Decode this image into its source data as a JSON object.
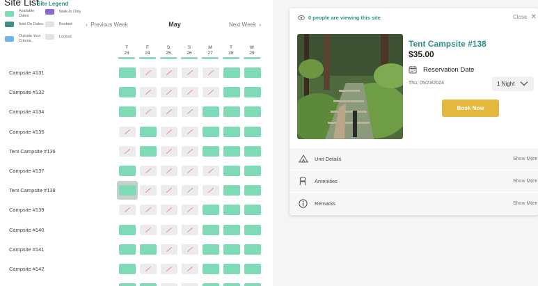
{
  "site_list": {
    "title": "Site List",
    "legend_link": "Site Legend",
    "legend": [
      {
        "label": "Available Dates",
        "color": "#7fdbb6"
      },
      {
        "label": "Add-On Dates",
        "color": "#3d8f86"
      },
      {
        "label": "Outside Your Criteria",
        "color": "#6fb4e8"
      },
      {
        "label": "Walk-In Only",
        "color": "#8c66d9",
        "glyph": "☰"
      },
      {
        "label": "Booked",
        "color": "#e3e3e3",
        "glyph": "∕"
      },
      {
        "label": "Locked",
        "color": "#e3e3e3",
        "glyph": "▣"
      }
    ]
  },
  "nav": {
    "prev_label": "Previous Week",
    "month": "May",
    "next_label": "Next Week"
  },
  "days": [
    {
      "dow": "T",
      "date": "23"
    },
    {
      "dow": "F",
      "date": "24"
    },
    {
      "dow": "S",
      "date": "25"
    },
    {
      "dow": "S",
      "date": "26"
    },
    {
      "dow": "M",
      "date": "27"
    },
    {
      "dow": "T",
      "date": "28"
    },
    {
      "dow": "W",
      "date": "29"
    }
  ],
  "sites": [
    {
      "name": "Campsite #131",
      "status": [
        "a",
        "b",
        "b",
        "b",
        "b",
        "a",
        "a"
      ]
    },
    {
      "name": "Campsite #132",
      "status": [
        "a",
        "b",
        "b",
        "b",
        "b",
        "a",
        "a"
      ]
    },
    {
      "name": "Campsite #134",
      "status": [
        "a",
        "b",
        "b",
        "b",
        "a",
        "a",
        "a"
      ]
    },
    {
      "name": "Campsite #135",
      "status": [
        "b",
        "a",
        "b",
        "b",
        "a",
        "a",
        "a"
      ]
    },
    {
      "name": "Tent Campsite #136",
      "status": [
        "b",
        "a",
        "b",
        "b",
        "a",
        "a",
        "a"
      ]
    },
    {
      "name": "Campsite #137",
      "status": [
        "a",
        "b",
        "b",
        "b",
        "b",
        "a",
        "a"
      ]
    },
    {
      "name": "Tent Campsite #138",
      "status": [
        "a",
        "b",
        "b",
        "b",
        "b",
        "a",
        "a"
      ]
    },
    {
      "name": "Campsite #139",
      "status": [
        "b",
        "b",
        "b",
        "b",
        "a",
        "a",
        "a"
      ]
    },
    {
      "name": "Campsite #140",
      "status": [
        "a",
        "b",
        "b",
        "b",
        "a",
        "a",
        "a"
      ]
    },
    {
      "name": "Campsite #141",
      "status": [
        "a",
        "a",
        "b",
        "b",
        "a",
        "a",
        "a"
      ]
    },
    {
      "name": "Campsite #142",
      "status": [
        "a",
        "b",
        "b",
        "b",
        "a",
        "a",
        "a"
      ]
    },
    {
      "name": "",
      "status": [
        "a",
        "a",
        "b",
        "b",
        "a",
        "a",
        "a"
      ]
    }
  ],
  "selected_site_index": 6,
  "detail": {
    "viewing_text": "0 people are viewing this site",
    "close_label": "Close",
    "site_name": "Tent Campsite #138",
    "price": "$35.00",
    "reservation_label": "Reservation Date",
    "date": "Thu, 05/23/2024",
    "nights": "1 Night",
    "book_label": "Book Now",
    "sections": [
      {
        "label": "Unit Details",
        "show": "Show More",
        "icon": "tent-icon"
      },
      {
        "label": "Amenities",
        "show": "Show More",
        "icon": "chair-icon"
      },
      {
        "label": "Remarks",
        "show": "Show More",
        "icon": "info-icon"
      }
    ]
  },
  "colors": {
    "accent": "#2e8c86",
    "available": "#7fdbb6",
    "booked": "#ececec",
    "book_button": "#e4b83c"
  }
}
